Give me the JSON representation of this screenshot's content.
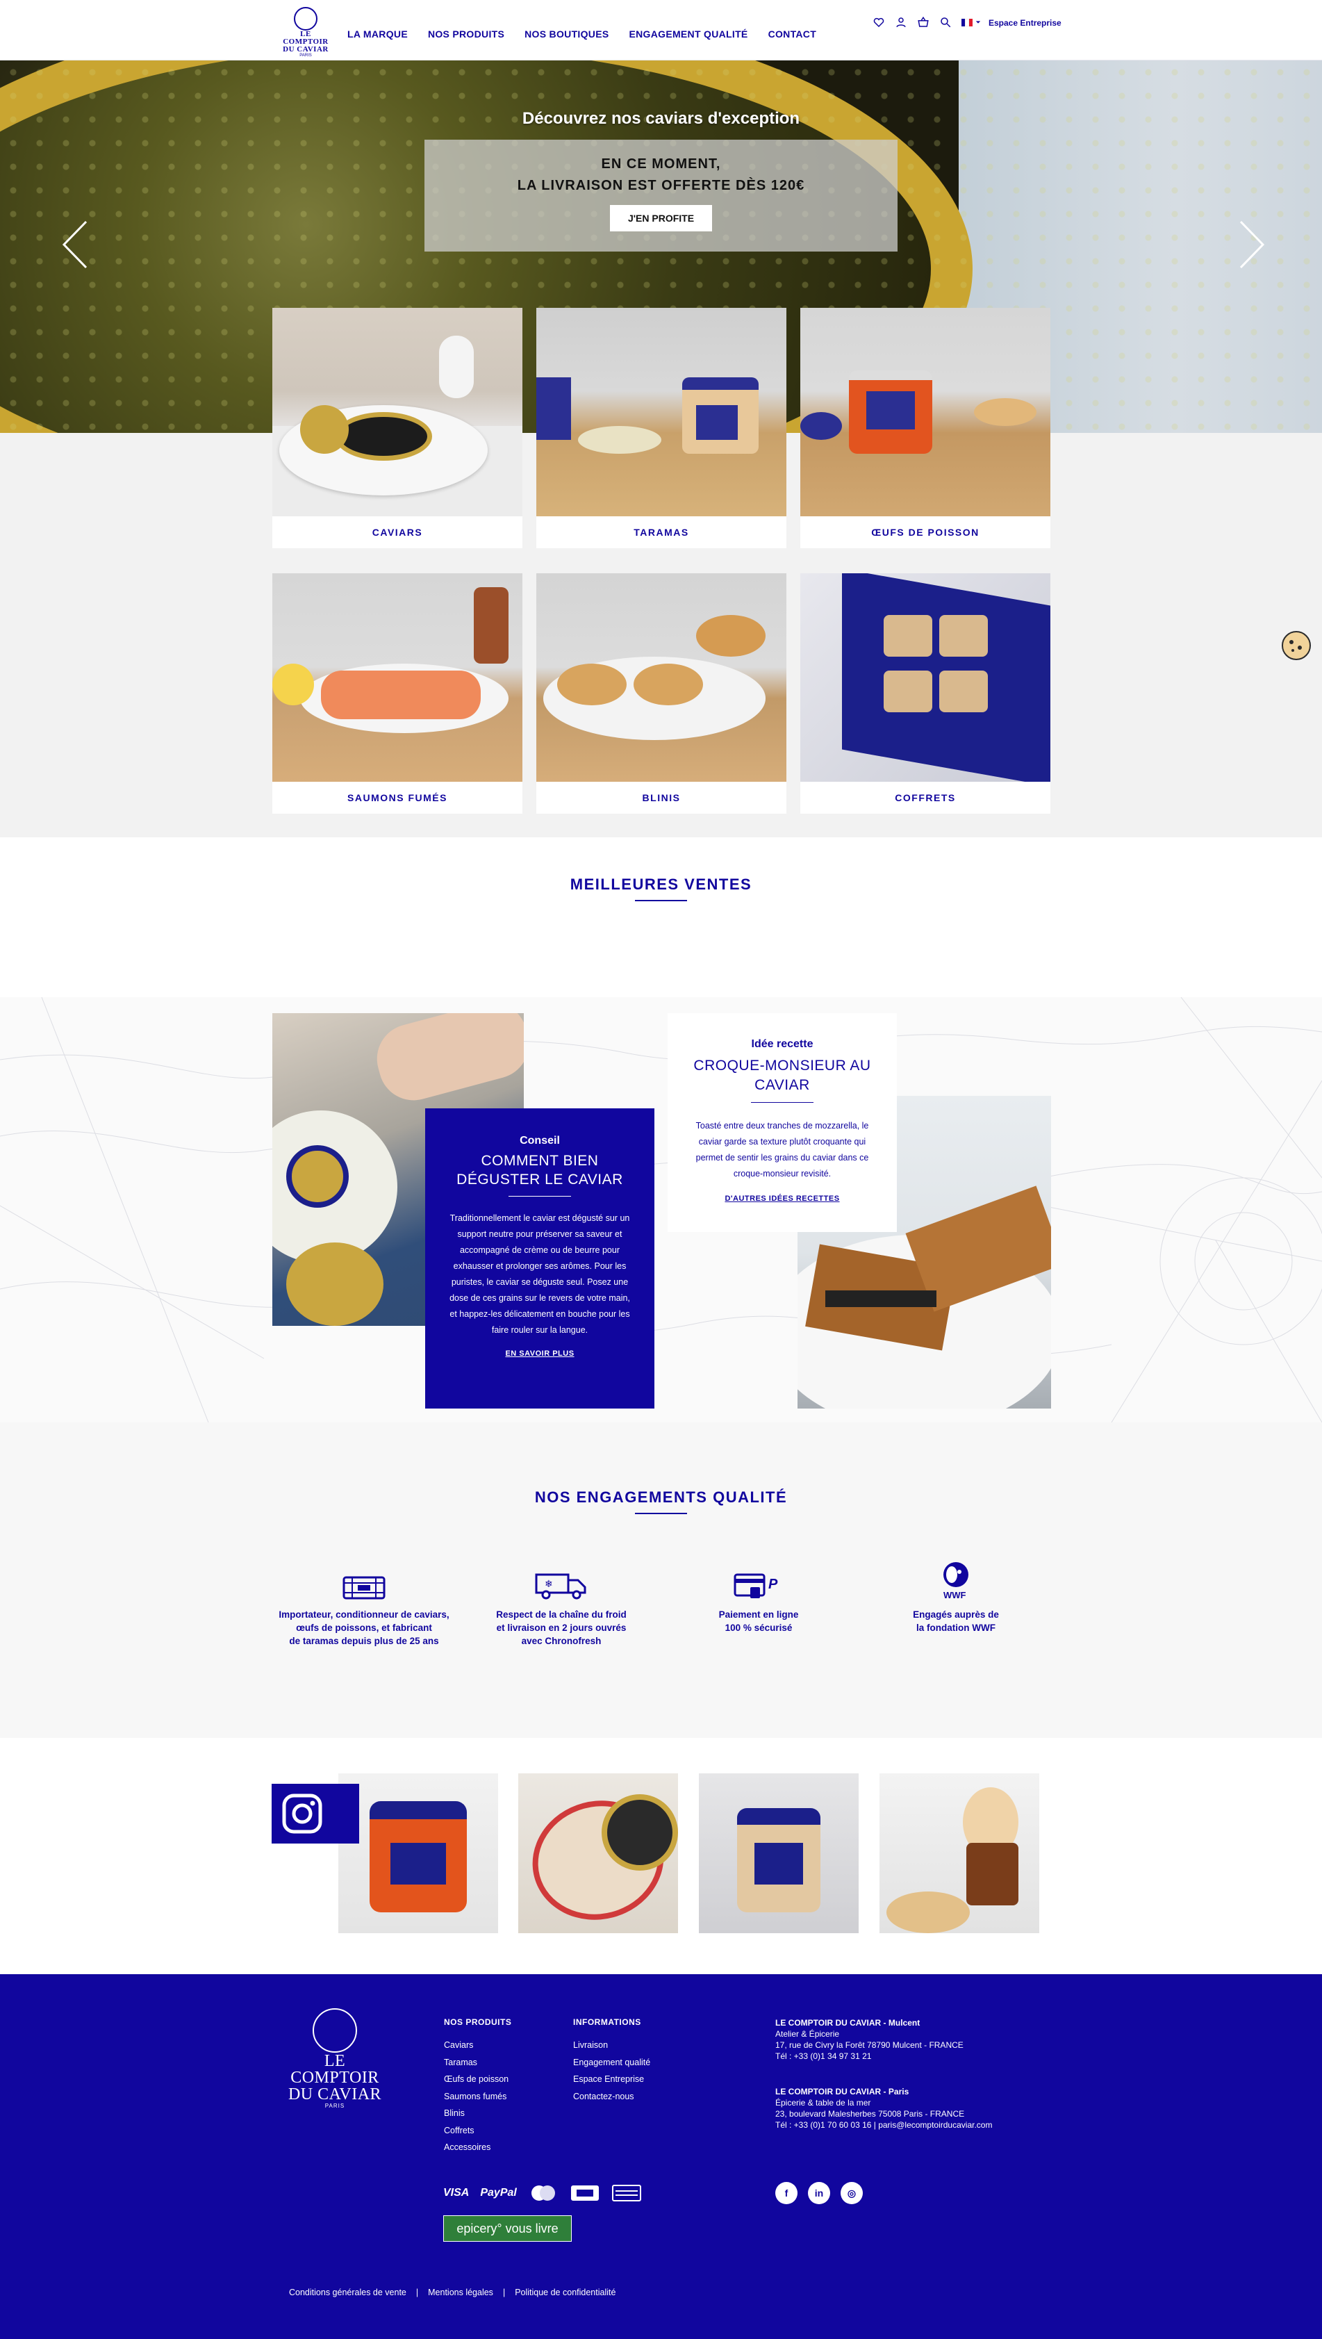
{
  "header": {
    "logo": {
      "line1": "LE COMPTOIR",
      "line2": "DU CAVIAR",
      "line3": "PARIS"
    },
    "nav": [
      "LA MARQUE",
      "NOS PRODUITS",
      "NOS BOUTIQUES",
      "ENGAGEMENT QUALITÉ",
      "CONTACT"
    ],
    "icons": [
      "heart-icon",
      "user-icon",
      "basket-icon",
      "search-icon",
      "flag-fr-icon"
    ],
    "espace_entreprise": "Espace Entreprise"
  },
  "hero": {
    "title": "Découvrez nos caviars d'exception",
    "promo_line1": "EN CE MOMENT,",
    "promo_line2": "LA LIVRAISON EST OFFERTE DÈS 120€",
    "promo_button": "J'EN PROFITE"
  },
  "categories": [
    {
      "label": "CAVIARS"
    },
    {
      "label": "TARAMAS"
    },
    {
      "label": "ŒUFS DE POISSON"
    },
    {
      "label": "SAUMONS FUMÉS"
    },
    {
      "label": "BLINIS"
    },
    {
      "label": "COFFRETS"
    }
  ],
  "best_sellers": {
    "title": "MEILLEURES VENTES"
  },
  "conseil": {
    "kicker": "Conseil",
    "title_line1": "COMMENT BIEN",
    "title_line2": "DÉGUSTER LE CAVIAR",
    "body": "Traditionnellement le caviar est dégusté sur un support neutre pour préserver sa saveur et accompagné de crème ou de beurre pour exhausser et prolonger ses arômes. Pour les puristes, le caviar se déguste seul. Posez une dose de ces grains sur le revers de votre main, et happez-les délicatement en bouche pour les faire rouler sur la langue.",
    "link": "EN SAVOIR PLUS"
  },
  "recette": {
    "kicker": "Idée recette",
    "title_line1": "CROQUE-MONSIEUR AU",
    "title_line2": "CAVIAR",
    "body": "Toasté entre deux tranches de mozzarella, le caviar garde sa texture plutôt croquante qui permet de sentir les grains du caviar dans ce croque-monsieur revisité.",
    "link": "D'AUTRES IDÉES RECETTES"
  },
  "engagements": {
    "title": "NOS ENGAGEMENTS QUALITÉ",
    "items": [
      {
        "icon": "crate-icon",
        "text_l1": "Importateur, conditionneur de caviars,",
        "text_l2": "œufs de poissons, et fabricant",
        "text_l3": "de taramas depuis plus de 25 ans"
      },
      {
        "icon": "delivery-truck-icon",
        "text_l1": "Respect de la chaîne du froid",
        "text_l2": "et livraison en 2 jours ouvrés",
        "text_l3": "avec Chronofresh"
      },
      {
        "icon": "payment-card-icon",
        "text_l1": "Paiement en ligne",
        "text_l2": "100 % sécurisé",
        "text_l3": ""
      },
      {
        "icon": "wwf-panda-icon",
        "text_l1": "Engagés auprès de",
        "text_l2": "la fondation WWF",
        "text_l3": ""
      }
    ]
  },
  "footer": {
    "logo": {
      "line1": "LE COMPTOIR",
      "line2": "DU CAVIAR",
      "line3": "PARIS"
    },
    "products_title": "NOS PRODUITS",
    "products": [
      "Caviars",
      "Taramas",
      "Œufs de poisson",
      "Saumons fumés",
      "Blinis",
      "Coffrets",
      "Accessoires"
    ],
    "info_title": "INFORMATIONS",
    "info": [
      "Livraison",
      "Engagement qualité",
      "Espace Entreprise",
      "Contactez-nous"
    ],
    "shop1": {
      "title": "LE COMPTOIR DU CAVIAR - Mulcent",
      "l1": "Atelier & Épicerie",
      "l2": "17, rue de Civry la Forêt 78790 Mulcent - FRANCE",
      "l3": "Tél : +33 (0)1 34 97 31 21"
    },
    "shop2": {
      "title": "LE COMPTOIR DU CAVIAR - Paris",
      "l1": "Épicerie & table de la mer",
      "l2": "23, boulevard Malesherbes 75008 Paris - FRANCE",
      "l3": "Tél : +33 (0)1 70 60 03 16 | paris@lecomptoirducaviar.com"
    },
    "payment": {
      "visa": "VISA",
      "paypal": "PayPal"
    },
    "epicery": "epicery° vous livre",
    "social": [
      "f",
      "in",
      "◎"
    ],
    "legal": [
      "Conditions générales de vente",
      "|",
      "Mentions légales",
      "|",
      "Politique de confidentialité"
    ]
  },
  "colors": {
    "brand": "#11069e",
    "background_gray": "#f2f2f2",
    "epicery_green": "#2f7f3a"
  }
}
